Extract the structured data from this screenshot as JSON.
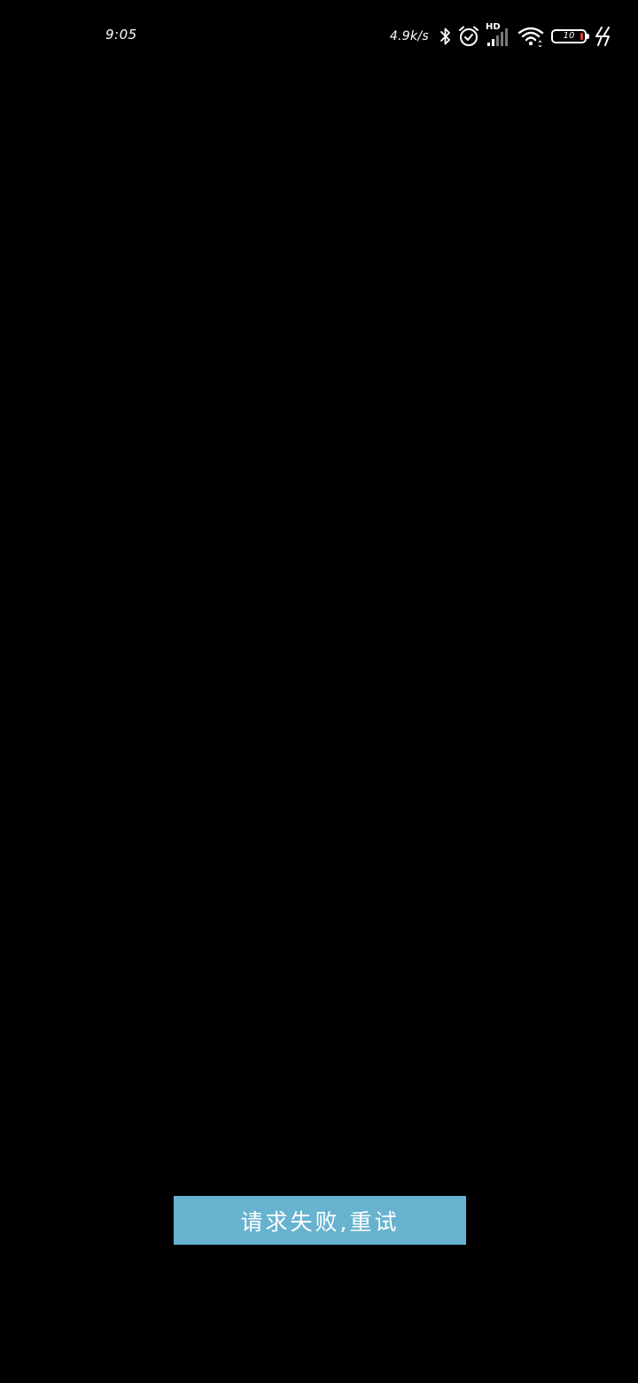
{
  "status_bar": {
    "time": "9:05",
    "net_speed": "4.9k/s",
    "network_label": "HD",
    "battery_level": "10",
    "icons": [
      "bluetooth-icon",
      "alarm-icon",
      "signal-icon",
      "wifi-icon",
      "battery-icon",
      "charging-icon"
    ]
  },
  "main": {
    "retry_label": "请求失败,重试",
    "button_color": "#67b3cf"
  }
}
